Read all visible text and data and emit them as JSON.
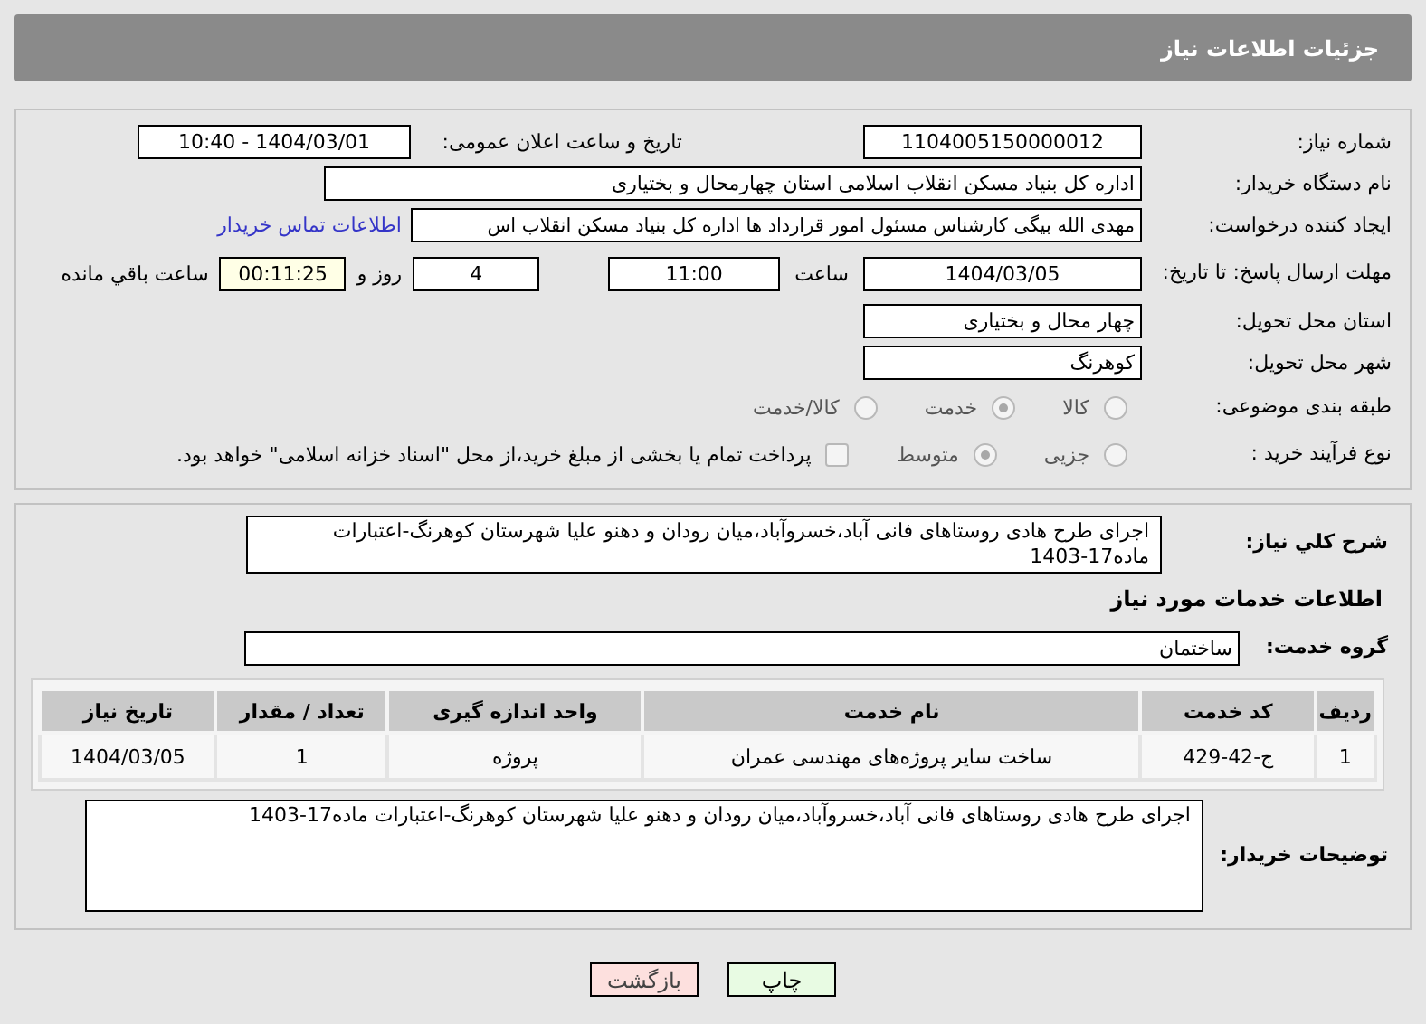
{
  "header": {
    "title": "جزئیات اطلاعات نیاز"
  },
  "need_number": {
    "label": "شماره نیاز:",
    "value": "1104005150000012"
  },
  "announce": {
    "label": "تاریخ و ساعت اعلان عمومی:",
    "value": "1404/03/01 - 10:40"
  },
  "buyer": {
    "label": "نام دستگاه خریدار:",
    "value": "اداره کل بنیاد مسکن انقلاب اسلامی استان چهارمحال و بختیاری"
  },
  "creator": {
    "label": "ایجاد کننده درخواست:",
    "value": "مهدی الله بیگی کارشناس مسئول امور قرارداد ها اداره کل بنیاد مسکن انقلاب اس",
    "link": "اطلاعات تماس خریدار"
  },
  "deadline": {
    "label": "مهلت ارسال پاسخ: تا تاریخ:",
    "date": "1404/03/05",
    "time_label": "ساعت",
    "time": "11:00",
    "days": "4",
    "days_label": "روز و",
    "remaining": "00:11:25",
    "remaining_label": "ساعت باقي مانده"
  },
  "province": {
    "label": "استان محل تحویل:",
    "value": "چهار محال و بختیاری"
  },
  "city": {
    "label": "شهر محل تحویل:",
    "value": "کوهرنگ"
  },
  "category": {
    "label": "طبقه بندی موضوعی:",
    "options": [
      {
        "label": "کالا",
        "selected": false
      },
      {
        "label": "خدمت",
        "selected": true
      },
      {
        "label": "کالا/خدمت",
        "selected": false
      }
    ]
  },
  "process": {
    "label": "نوع فرآیند خرید :",
    "options": [
      {
        "label": "جزیی",
        "selected": false
      },
      {
        "label": "متوسط",
        "selected": true
      }
    ],
    "treasury": {
      "checked": false,
      "label": "پرداخت تمام یا بخشی از مبلغ خرید،از محل \"اسناد خزانه اسلامی\" خواهد بود."
    }
  },
  "description": {
    "label": "شرح کلي نیاز:",
    "value": "اجرای طرح هادی روستاهای فانی آباد،خسروآباد،میان رودان و دهنو علیا شهرستان کوهرنگ-اعتبارات ماده17-1403"
  },
  "services_heading": "اطلاعات خدمات مورد نیاز",
  "service_group": {
    "label": "گروه خدمت:",
    "value": "ساختمان"
  },
  "table": {
    "columns": [
      "ردیف",
      "کد خدمت",
      "نام خدمت",
      "واحد اندازه گیری",
      "تعداد / مقدار",
      "تاریخ نیاز"
    ],
    "rows": [
      [
        "1",
        "ج-42-429",
        "ساخت سایر پروژه‌های مهندسی عمران",
        "پروژه",
        "1",
        "1404/03/05"
      ]
    ]
  },
  "buyer_notes": {
    "label": "توضیحات خریدار:",
    "value": "اجرای طرح هادی روستاهای فانی آباد،خسروآباد،میان رودان و دهنو علیا شهرستان کوهرنگ-اعتبارات ماده17-1403"
  },
  "buttons": [
    {
      "kind": "print",
      "label": "چاپ"
    },
    {
      "kind": "back",
      "label": "بازگشت"
    }
  ]
}
